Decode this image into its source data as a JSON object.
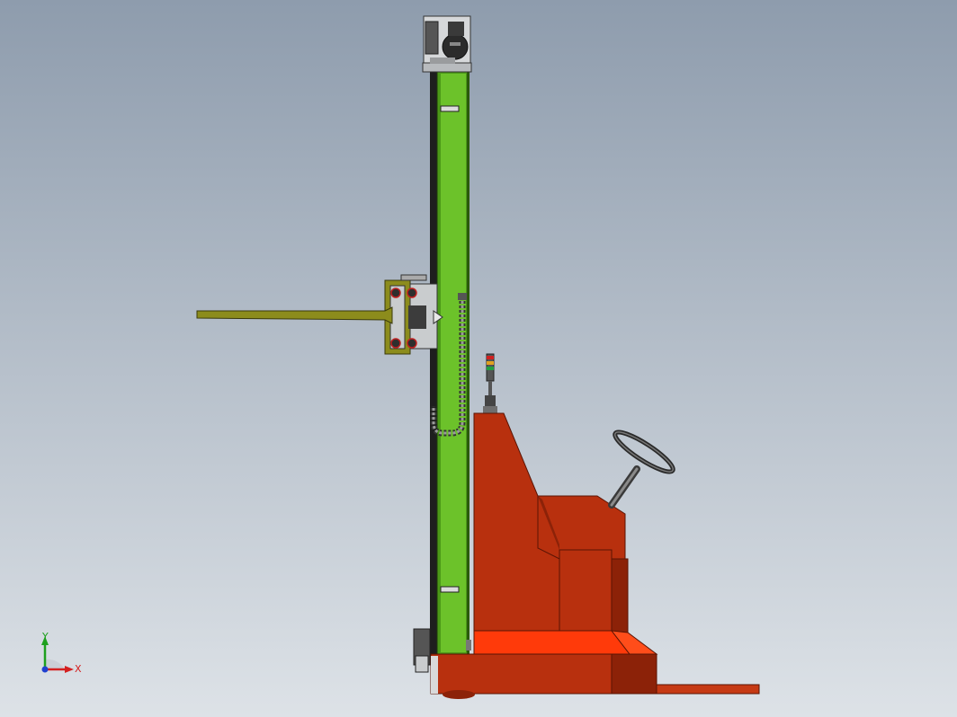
{
  "viewport": {
    "background_top": "#8e9cad",
    "background_bottom": "#dde2e7"
  },
  "model": {
    "colors": {
      "mast_green": "#4c9a18",
      "mast_green_light": "#6cc22a",
      "body_red": "#b8300e",
      "body_red_light": "#ff3a0a",
      "body_red_dark": "#8c2208",
      "fork_olive": "#8c8c1c",
      "steel_gray": "#6e6e6e",
      "carriage_gray": "#c9ccce",
      "dark": "#1e1e1e"
    }
  },
  "triad": {
    "x_label": "X",
    "y_label": "Y",
    "x_color": "#d42020",
    "y_color": "#1ea01e",
    "z_color": "#2040d0"
  }
}
